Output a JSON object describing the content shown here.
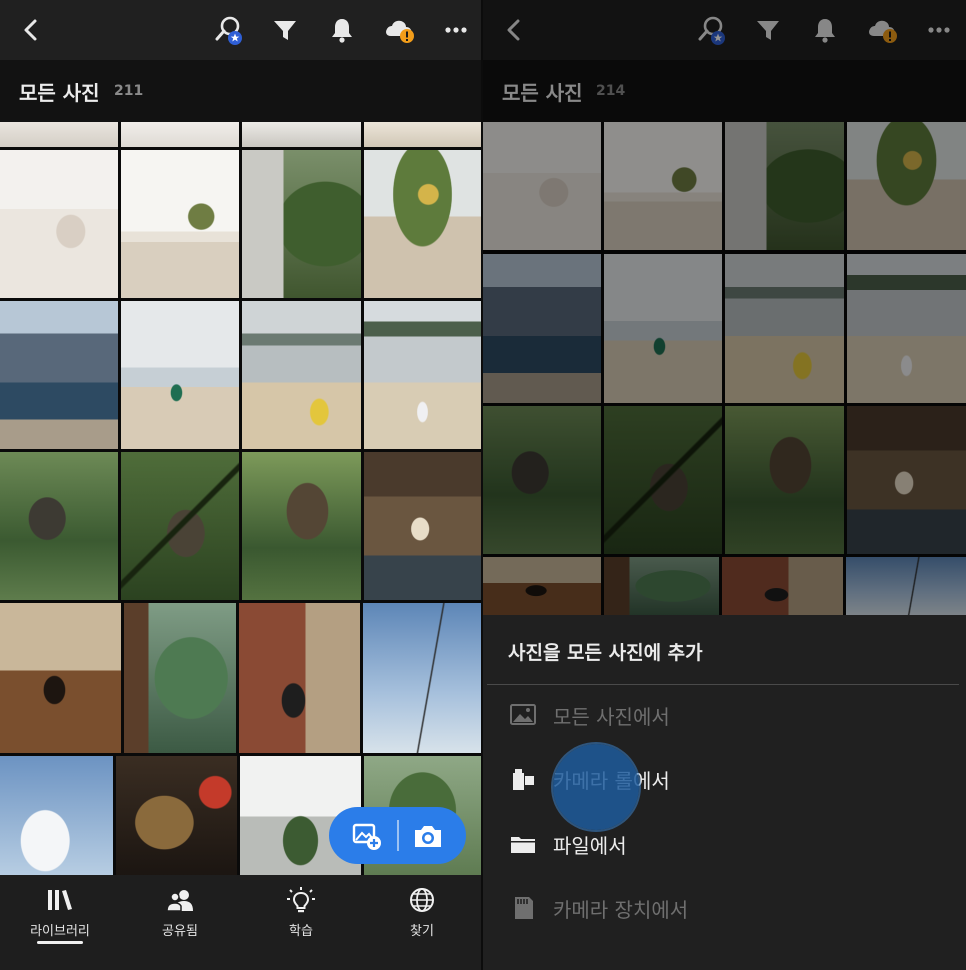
{
  "colors": {
    "accent": "#2b7de9",
    "topbar": "#202020",
    "titlebar": "#121212",
    "sheet": "#202020",
    "badge_star": "#2f5fd6",
    "badge_warning": "#f29d1a"
  },
  "left": {
    "header_icons": [
      "back-icon",
      "search-people-icon",
      "filter-icon",
      "bell-icon",
      "cloud-warning-icon",
      "more-icon"
    ],
    "title": "모든 사진",
    "count": "211",
    "nav": [
      {
        "label": "라이브러리",
        "icon": "library-icon",
        "active": true
      },
      {
        "label": "공유됨",
        "icon": "shared-people-icon",
        "active": false
      },
      {
        "label": "학습",
        "icon": "lightbulb-icon",
        "active": false
      },
      {
        "label": "찾기",
        "icon": "globe-icon",
        "active": false
      }
    ],
    "fab": {
      "icons": [
        "add-photo-icon",
        "camera-icon"
      ]
    }
  },
  "right": {
    "header_icons": [
      "back-icon",
      "search-people-icon",
      "filter-icon",
      "bell-icon",
      "cloud-warning-icon",
      "more-icon"
    ],
    "title": "모든 사진",
    "count": "214",
    "sheet": {
      "title": "사진을 모든 사진에 추가",
      "options": [
        {
          "label": "모든 사진에서",
          "icon": "image-icon",
          "enabled": false
        },
        {
          "label": "카메라 롤에서",
          "icon": "camera-roll-icon",
          "enabled": true
        },
        {
          "label": "파일에서",
          "icon": "folder-icon",
          "enabled": true
        },
        {
          "label": "카메라 장치에서",
          "icon": "sd-card-icon",
          "enabled": false
        }
      ]
    }
  },
  "photos": [
    "living-room-ceiling",
    "window-light",
    "house-window",
    "window-plant",
    "woman-on-sofa",
    "wooden-chairs-plant",
    "ivy-wall-courtyard",
    "wall-flowers",
    "market-crowd",
    "beach-umbrella",
    "beach-float",
    "beach-person",
    "hanok-garden",
    "bamboo-hanok",
    "pavilion-trees",
    "woman-on-bench",
    "coffee-on-table",
    "window-forest",
    "kitchen-cook",
    "power-lines-sky",
    "sky-clouds",
    "grilled-fish-soda",
    "balcony-plants",
    "tree-leaves"
  ]
}
